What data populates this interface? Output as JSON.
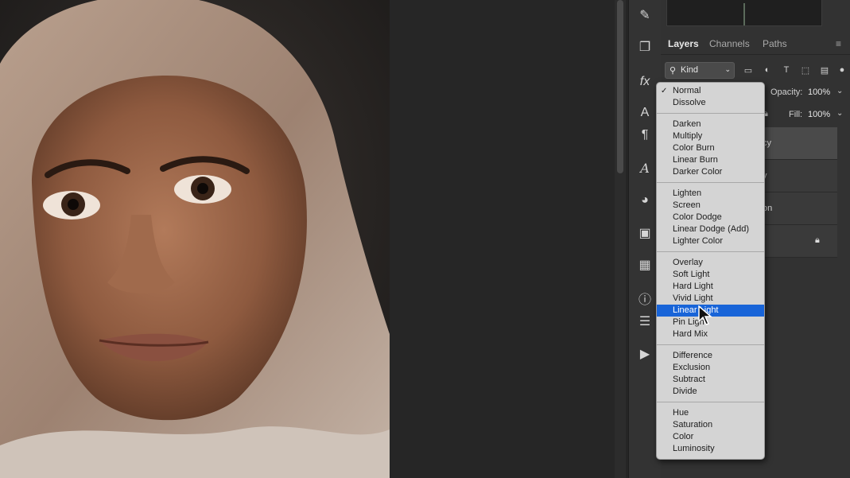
{
  "layers_panel": {
    "tabs": [
      {
        "label": "Layers",
        "active": true
      },
      {
        "label": "Channels",
        "active": false
      },
      {
        "label": "Paths",
        "active": false
      }
    ],
    "filter_kind": "Kind",
    "opacity_label": "Opacity:",
    "opacity_value": "100%",
    "fill_label": "Fill:",
    "fill_value": "100%",
    "layer_rows": [
      {
        "label_fragment": "cy",
        "selected": true
      },
      {
        "label_fragment": "y",
        "selected": false
      },
      {
        "label_fragment": "on",
        "selected": false
      },
      {
        "label_fragment": "",
        "selected": false,
        "locked": true
      }
    ]
  },
  "blend_mode_menu": {
    "checked_item": "Normal",
    "highlighted_item": "Linear Light",
    "groups": [
      [
        "Normal",
        "Dissolve"
      ],
      [
        "Darken",
        "Multiply",
        "Color Burn",
        "Linear Burn",
        "Darker Color"
      ],
      [
        "Lighten",
        "Screen",
        "Color Dodge",
        "Linear Dodge (Add)",
        "Lighter Color"
      ],
      [
        "Overlay",
        "Soft Light",
        "Hard Light",
        "Vivid Light",
        "Linear Light",
        "Pin Light",
        "Hard Mix"
      ],
      [
        "Difference",
        "Exclusion",
        "Subtract",
        "Divide"
      ],
      [
        "Hue",
        "Saturation",
        "Color",
        "Luminosity"
      ]
    ]
  },
  "tool_strip": [
    "brush-settings-icon",
    "clone-source-icon",
    "fx-styles-icon",
    "character-icon",
    "paragraph-icon",
    "glyphs-icon",
    "color-palette-icon",
    "gradients-icon",
    "swatches-grid-icon",
    "info-icon",
    "adjustments-icon",
    "actions-play-icon"
  ],
  "colors": {
    "menu_highlight": "#1864d8",
    "menu_bg": "#d4d4d4",
    "panel_bg": "#323232"
  }
}
